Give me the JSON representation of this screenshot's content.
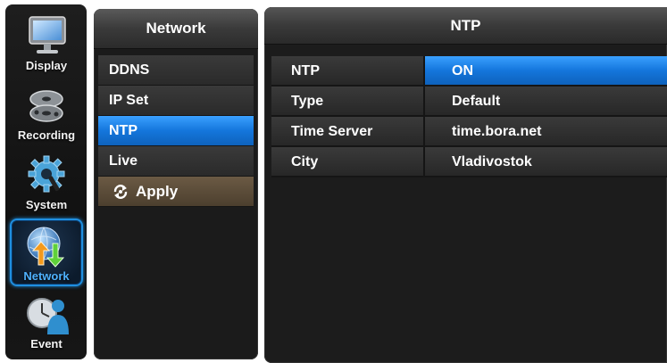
{
  "sidebar": {
    "items": [
      {
        "label": "Display",
        "icon": "monitor-icon",
        "active": false
      },
      {
        "label": "Recording",
        "icon": "reels-icon",
        "active": false
      },
      {
        "label": "System",
        "icon": "gear-icon",
        "active": false
      },
      {
        "label": "Network",
        "icon": "globe-arrows-icon",
        "active": true
      },
      {
        "label": "Event",
        "icon": "clock-person-icon",
        "active": false
      }
    ]
  },
  "menu": {
    "title": "Network",
    "items": [
      "DDNS",
      "IP Set",
      "NTP",
      "Live"
    ],
    "selected": "NTP",
    "apply_label": "Apply"
  },
  "panel": {
    "title": "NTP",
    "rows": [
      {
        "key": "NTP",
        "value": "ON"
      },
      {
        "key": "Type",
        "value": "Default"
      },
      {
        "key": "Time Server",
        "value": "time.bora.net"
      },
      {
        "key": "City",
        "value": "Vladivostok"
      }
    ]
  },
  "colors": {
    "selection_blue": "#1476dc",
    "apply_brown": "#5a4a36",
    "active_outline": "#1f8fe0"
  }
}
